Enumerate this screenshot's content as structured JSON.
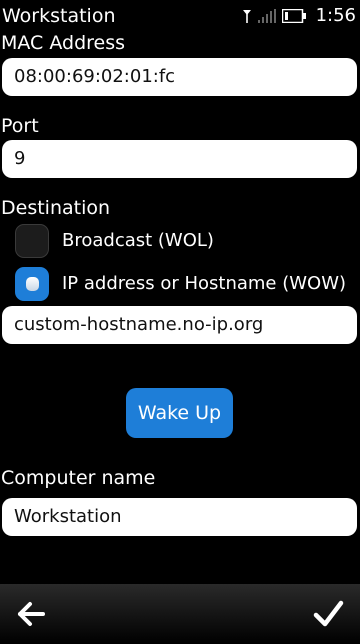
{
  "status_bar": {
    "title": "Workstation",
    "time": "1:56",
    "icons": [
      "signal-antenna-icon",
      "signal-strength-icon",
      "battery-icon"
    ]
  },
  "form": {
    "mac": {
      "label": "MAC Address",
      "value": "08:00:69:02:01:fc"
    },
    "port": {
      "label": "Port",
      "value": "9"
    },
    "destination": {
      "label": "Destination",
      "options": [
        {
          "label": "Broadcast (WOL)",
          "selected": false
        },
        {
          "label": "IP address or Hostname (WOW)",
          "selected": true
        }
      ],
      "host_value": "custom-hostname.no-ip.org"
    },
    "wake_button": "Wake Up",
    "computer_name": {
      "label": "Computer name",
      "value": "Workstation"
    }
  },
  "toolbar": {
    "back": "back-arrow-icon",
    "confirm": "checkmark-icon"
  },
  "colors": {
    "background": "#000000",
    "accent": "#1e7ed8",
    "field_background": "#ffffff",
    "text": "#ffffff"
  }
}
